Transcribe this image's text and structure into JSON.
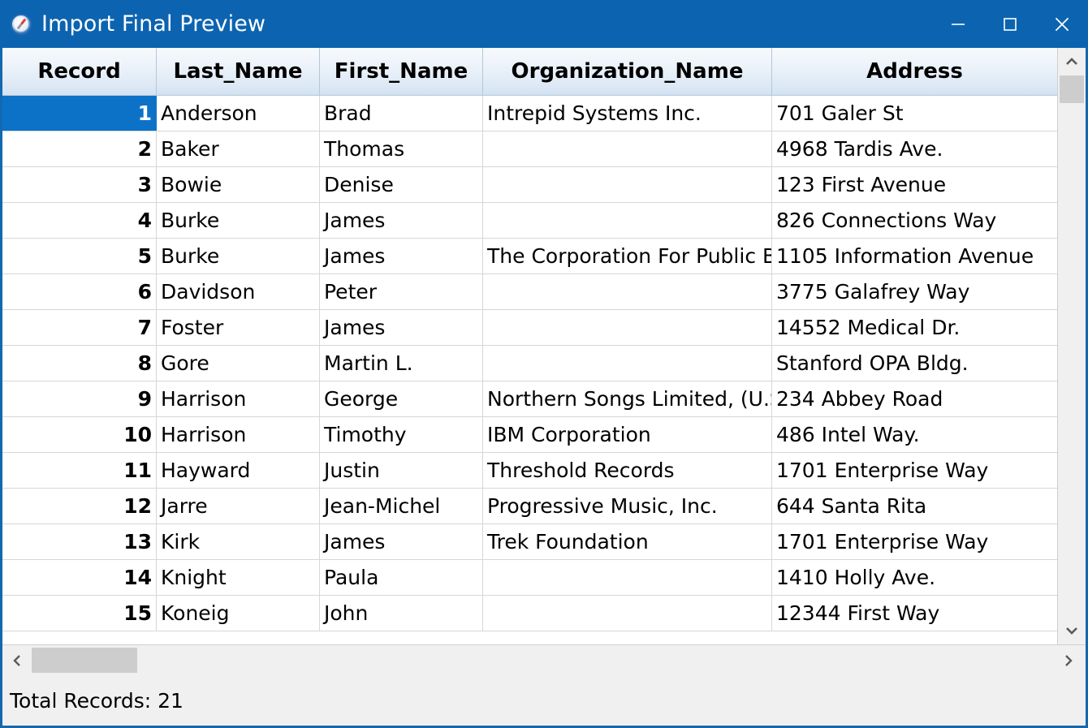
{
  "window": {
    "title": "Import Final Preview",
    "icon": "compass-icon",
    "accent_color": "#0c64b0",
    "border_color": "#1368b0",
    "selection_color": "#0c72c8",
    "controls": [
      {
        "name": "minimize",
        "glyph": "minimize-icon"
      },
      {
        "name": "maximize",
        "glyph": "maximize-icon"
      },
      {
        "name": "close",
        "glyph": "close-icon"
      }
    ]
  },
  "grid": {
    "columns": [
      {
        "key": "record",
        "label": "Record"
      },
      {
        "key": "last_name",
        "label": "Last_Name"
      },
      {
        "key": "first_name",
        "label": "First_Name"
      },
      {
        "key": "organization_name",
        "label": "Organization_Name"
      },
      {
        "key": "address",
        "label": "Address"
      }
    ],
    "selected_row_index": 0,
    "rows": [
      {
        "record": "1",
        "last_name": "Anderson",
        "first_name": "Brad",
        "organization_name": "Intrepid Systems Inc.",
        "address": "701 Galer St"
      },
      {
        "record": "2",
        "last_name": "Baker",
        "first_name": "Thomas",
        "organization_name": "",
        "address": "4968 Tardis Ave."
      },
      {
        "record": "3",
        "last_name": "Bowie",
        "first_name": "Denise",
        "organization_name": "",
        "address": "123 First Avenue"
      },
      {
        "record": "4",
        "last_name": "Burke",
        "first_name": "James",
        "organization_name": "",
        "address": "826 Connections Way"
      },
      {
        "record": "5",
        "last_name": "Burke",
        "first_name": "James",
        "organization_name": "The Corporation For Public Broadcasting",
        "address": "1105 Information Avenue"
      },
      {
        "record": "6",
        "last_name": "Davidson",
        "first_name": "Peter",
        "organization_name": "",
        "address": "3775 Galafrey Way"
      },
      {
        "record": "7",
        "last_name": "Foster",
        "first_name": "James",
        "organization_name": "",
        "address": "14552 Medical Dr."
      },
      {
        "record": "8",
        "last_name": "Gore",
        "first_name": "Martin L.",
        "organization_name": "",
        "address": "Stanford OPA Bldg."
      },
      {
        "record": "9",
        "last_name": "Harrison",
        "first_name": "George",
        "organization_name": "Northern Songs Limited, (U.S.A.)",
        "address": "234 Abbey Road"
      },
      {
        "record": "10",
        "last_name": "Harrison",
        "first_name": "Timothy",
        "organization_name": "IBM Corporation",
        "address": "486 Intel Way."
      },
      {
        "record": "11",
        "last_name": "Hayward",
        "first_name": "Justin",
        "organization_name": "Threshold Records",
        "address": "1701 Enterprise Way"
      },
      {
        "record": "12",
        "last_name": "Jarre",
        "first_name": "Jean-Michel",
        "organization_name": "Progressive Music, Inc.",
        "address": "644 Santa Rita"
      },
      {
        "record": "13",
        "last_name": "Kirk",
        "first_name": "James",
        "organization_name": "Trek Foundation",
        "address": "1701 Enterprise Way"
      },
      {
        "record": "14",
        "last_name": "Knight",
        "first_name": "Paula",
        "organization_name": "",
        "address": "1410 Holly Ave."
      },
      {
        "record": "15",
        "last_name": "Koneig",
        "first_name": "John",
        "organization_name": "",
        "address": "12344 First Way"
      }
    ]
  },
  "scrollbars": {
    "vertical": {
      "up_icon": "chevron-up-icon",
      "down_icon": "chevron-down-icon"
    },
    "horizontal": {
      "left_icon": "chevron-left-icon",
      "right_icon": "chevron-right-icon"
    }
  },
  "statusbar": {
    "total_records_text": "Total Records: 21"
  }
}
